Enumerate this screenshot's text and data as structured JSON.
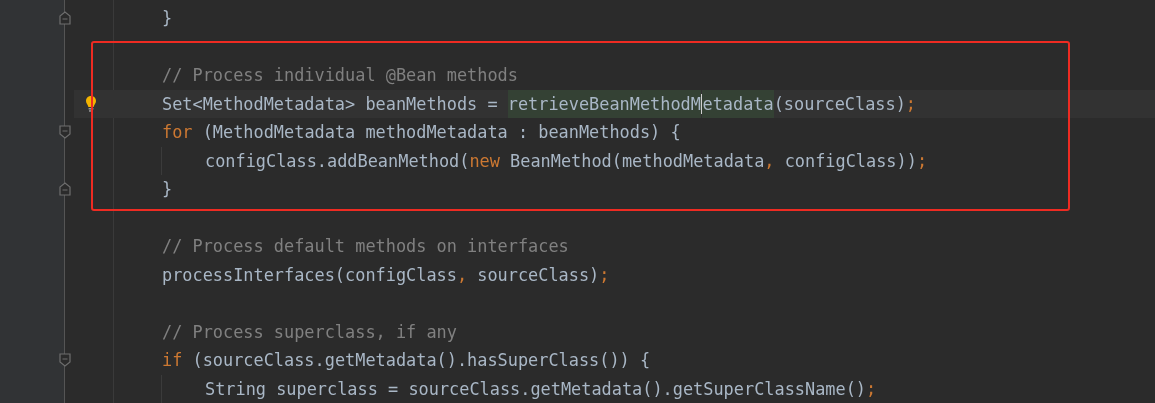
{
  "editor": {
    "lines": [
      {
        "indented": false,
        "fold_start": false,
        "fold_end": true,
        "current": false,
        "bulb": false,
        "tokens": [
          {
            "kind": "plain",
            "text": "}"
          }
        ]
      },
      {
        "indented": false,
        "fold_start": false,
        "fold_end": false,
        "current": false,
        "bulb": false
      },
      {
        "indented": false,
        "fold_start": false,
        "fold_end": false,
        "current": false,
        "bulb": false,
        "tokens": [
          {
            "kind": "comment",
            "text": "// Process individual @Bean methods"
          }
        ]
      },
      {
        "indented": false,
        "fold_start": false,
        "fold_end": false,
        "current": true,
        "bulb": true,
        "tokens": [
          {
            "kind": "plain",
            "text": "Set<MethodMetadata> beanMethods = "
          },
          {
            "kind": "usage",
            "text": "retrieveBeanMethodM"
          },
          {
            "kind": "caret"
          },
          {
            "kind": "usage",
            "text": "etadata"
          },
          {
            "kind": "plain",
            "text": "(sourceClass)"
          },
          {
            "kind": "punct",
            "text": ";"
          }
        ]
      },
      {
        "indented": false,
        "fold_start": true,
        "fold_end": false,
        "current": false,
        "bulb": false,
        "tokens": [
          {
            "kind": "keyword",
            "text": "for "
          },
          {
            "kind": "plain",
            "text": "(MethodMetadata methodMetadata : beanMethods) {"
          }
        ]
      },
      {
        "indented": true,
        "fold_start": false,
        "fold_end": false,
        "current": false,
        "bulb": false,
        "tokens": [
          {
            "kind": "plain",
            "text": "configClass.addBeanMethod("
          },
          {
            "kind": "keyword",
            "text": "new "
          },
          {
            "kind": "plain",
            "text": "BeanMethod(methodMetadata"
          },
          {
            "kind": "punct",
            "text": ", "
          },
          {
            "kind": "plain",
            "text": "configClass))"
          },
          {
            "kind": "punct",
            "text": ";"
          }
        ]
      },
      {
        "indented": false,
        "fold_start": false,
        "fold_end": true,
        "current": false,
        "bulb": false,
        "tokens": [
          {
            "kind": "plain",
            "text": "}"
          }
        ]
      },
      {
        "indented": false,
        "fold_start": false,
        "fold_end": false,
        "current": false,
        "bulb": false
      },
      {
        "indented": false,
        "fold_start": false,
        "fold_end": false,
        "current": false,
        "bulb": false,
        "tokens": [
          {
            "kind": "comment",
            "text": "// Process default methods on interfaces"
          }
        ]
      },
      {
        "indented": false,
        "fold_start": false,
        "fold_end": false,
        "current": false,
        "bulb": false,
        "tokens": [
          {
            "kind": "plain",
            "text": "processInterfaces(configClass"
          },
          {
            "kind": "punct",
            "text": ", "
          },
          {
            "kind": "plain",
            "text": "sourceClass)"
          },
          {
            "kind": "punct",
            "text": ";"
          }
        ]
      },
      {
        "indented": false,
        "fold_start": false,
        "fold_end": false,
        "current": false,
        "bulb": false
      },
      {
        "indented": false,
        "fold_start": false,
        "fold_end": false,
        "current": false,
        "bulb": false,
        "tokens": [
          {
            "kind": "comment",
            "text": "// Process superclass, if any"
          }
        ]
      },
      {
        "indented": false,
        "fold_start": true,
        "fold_end": false,
        "current": false,
        "bulb": false,
        "tokens": [
          {
            "kind": "keyword",
            "text": "if "
          },
          {
            "kind": "plain",
            "text": "(sourceClass.getMetadata().hasSuperClass()) {"
          }
        ]
      },
      {
        "indented": true,
        "fold_start": false,
        "fold_end": false,
        "current": false,
        "bulb": false,
        "tokens": [
          {
            "kind": "plain",
            "text": "String superclass = sourceClass.getMetadata().getSuperClassName()"
          },
          {
            "kind": "punct",
            "text": ";"
          }
        ]
      }
    ]
  }
}
